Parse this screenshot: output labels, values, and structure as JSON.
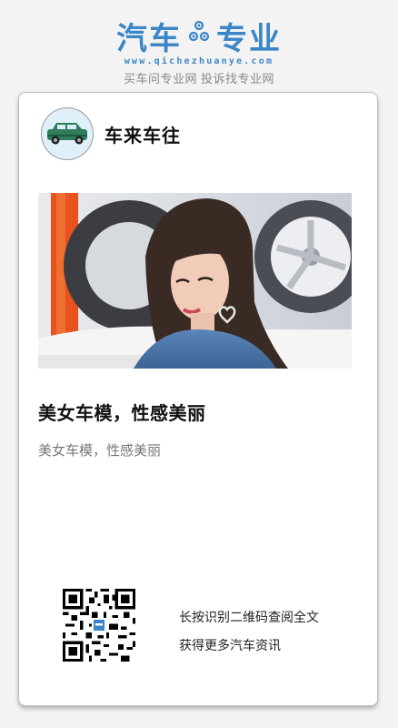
{
  "header": {
    "brand_left": "汽车",
    "brand_right": "专业",
    "brand_icon": "gears-icon",
    "url": "www.qichezhuanye.com",
    "slogan": "买车问专业网 投诉找专业网",
    "brand_color": "#3a86c6"
  },
  "card": {
    "author": {
      "name": "车来车往",
      "avatar_icon": "green-suv-icon"
    },
    "image": {
      "description_icon": "photo-icon"
    },
    "title": "美女车模，性感美丽",
    "summary": "美女车模，性感美丽",
    "qr_icon": "qr-code-icon",
    "qr_lines": [
      "长按识别二维码查阅全文",
      "获得更多汽车资讯"
    ]
  }
}
